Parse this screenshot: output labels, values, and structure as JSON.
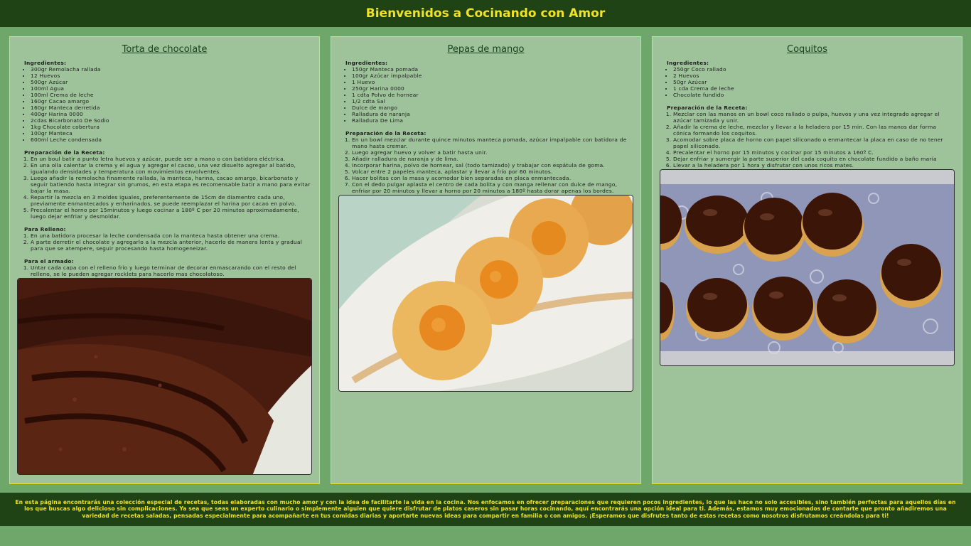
{
  "header": {
    "title": "Bienvenidos a Cocinando con Amor"
  },
  "recipes": [
    {
      "title": "Torta de chocolate",
      "ingredients_label": "Ingredientes:",
      "ingredients": [
        "300gr Remolacha rallada",
        "12 Huevos",
        "500gr Azúcar",
        "100ml Agua",
        "100ml Crema de leche",
        "160gr Cacao amargo",
        "160gr Manteca derretida",
        "400gr Harina 0000",
        "2cdas Bicarbonato De Sodio",
        "1kg Chocolate cobertura",
        "100gr Manteca",
        "600ml Leche condensada"
      ],
      "prep_label": "Preparación de la Receta:",
      "steps": [
        "En un boul batir a punto letra huevos y azúcar, puede ser a mano o con batidora eléctrica.",
        "En una olla calentar la crema y el agua y agregar el cacao, una vez disuelto agregar al batido, igualando densidades y temperatura con movimientos envolventes.",
        "Luego añadir la remolacha finamente rallada, la manteca, harina, cacao amargo, bicarbonato y seguir batiendo hasta integrar sin grumos, en esta etapa es recomensable batir a mano para evitar bajar la masa.",
        "Repartir la mezcla en 3 moldes iguales, preferentemente de 15cm de diamentro cada uno, previamente enmantecados y enharinados, se puede reemplazar el harina por cacao en polvo.",
        "Precalentar el horno por 15minutos y luego cocinar a 180º C por 20 minutos aproximadamente, luego dejar enfriar y desmoldar."
      ],
      "filling_label": "Para Relleno:",
      "filling_steps": [
        "En una batidora procesar la leche condensada con la manteca hasta obtener una crema.",
        "A parte derretir el chocolate y agregarlo a la mezcla anterior, hacerlo de manera lenta y gradual para que se atempere, seguir procesando hasta homogeneizar."
      ],
      "assembly_label": "Para el armado:",
      "assembly_steps": [
        "Untar cada capa con el relleno frío y luego terminar de decorar enmascarando con el resto del relleno, se le pueden agregar rocklets para hacerlo mas chocolatoso."
      ]
    },
    {
      "title": "Pepas de mango",
      "ingredients_label": "Ingredientes:",
      "ingredients": [
        "150gr Manteca pomada",
        "100gr Azúcar impalpable",
        "1 Huevo",
        "250gr Harina 0000",
        "1 cdta Polvo de hornear",
        "1/2 cdta Sal",
        "Dulce de mango",
        "Ralladura de naranja",
        "Ralladura De Lima"
      ],
      "prep_label": "Preparación de la Receta:",
      "steps": [
        "En un bowl mezclar durante quince minutos manteca pomada, azúcar impalpable con batidora de mano hasta cremar.",
        "Luego agregar huevo y volver a batir hasta unir.",
        "Añadir ralladura de naranja y de lima.",
        "Incorporar harina, polvo de hornear, sal (todo tamizado) y trabajar con espátula de goma.",
        "Volcar entre 2 papeles manteca, aplastar y llevar a frío por 60 minutos.",
        "Hacer bolitas con la masa y acomodar bien separadas en placa enmantecada.",
        "Con el dedo pulgar aplasta el centro de cada bolita y con manga rellenar con dulce de mango, enfriar por 20 minutos y llevar a horno por 20 minutos a 180º hasta dorar apenas los bordes."
      ]
    },
    {
      "title": "Coquitos",
      "ingredients_label": "Ingredientes:",
      "ingredients": [
        "250gr Coco rallado",
        "2 Huevos",
        "50gr Azúcar",
        "1 cda Crema de leche",
        "Chocolate fundido"
      ],
      "prep_label": "Preparación de la Receta:",
      "steps": [
        "Mezclar con las manos en un bowl coco rallado o pulpa, huevos y una vez integrado agregar el azúcar tamizada y unir.",
        "Añadir la crema de leche, mezclar y llevar a la heladera por 15 min. Con las manos dar forma cónica formando los coquitos.",
        "Acomodar sobre placa de horno con papel siliconado o enmantecar la placa en caso de no tener papel siliconado.",
        "Precalentar el horno por 15 minutos y cocinar por 15 minutos a 160º C.",
        "Dejar enfriar y sumergir la parte superior del cada coquito en chocolate fundido a baño maría",
        "Llevar a la heladera por 1 hora y disfrutar con unos ricos mates."
      ]
    }
  ],
  "footer": {
    "text": "En esta página encontrarás una colección especial de recetas, todas elaboradas con mucho amor y con la idea de facilitarte la vida en la cocina. Nos enfocamos en ofrecer preparaciones que requieren pocos ingredientes, lo que las hace no solo accesibles, sino también perfectas para aquellos días en los que buscas algo delicioso sin complicaciones. Ya sea que seas un experto culinario o simplemente alguien que quiere disfrutar de platos caseros sin pasar horas cocinando, aquí encontrarás una opción ideal para ti. Además, estamos muy emocionados de contarte que pronto añadiremos una variedad de recetas saladas, pensadas especialmente para acompañarte en tus comidas diarias y aportarte nuevas ideas para compartir en familia o con amigos. ¡Esperamos que disfrutes tanto de estas recetas como nosotros disfrutamos creándolas para ti!"
  }
}
